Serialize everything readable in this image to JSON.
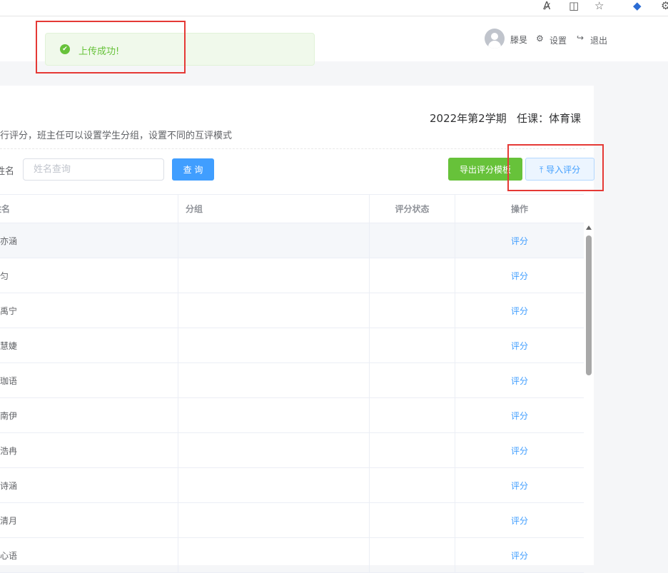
{
  "toast": {
    "message": "上传成功!"
  },
  "header": {
    "username": "滕旻",
    "settings_label": "设置",
    "logout_label": "退出"
  },
  "semester_info": "2022年第2学期   任课：体育课",
  "description": "行评分，班主任可以设置学生分组，设置不同的互评模式",
  "search": {
    "label": "姓名",
    "placeholder": "姓名查询",
    "query_button": "查 询",
    "export_button": "导出评分模板",
    "import_button": "导入评分"
  },
  "table": {
    "headers": {
      "name": "姓名",
      "group": "分组",
      "status": "评分状态",
      "action": "操作"
    },
    "rows": [
      {
        "name": "傅亦涵",
        "group": "",
        "status": "",
        "action": "评分"
      },
      {
        "name": "高匀",
        "group": "",
        "status": "",
        "action": "评分"
      },
      {
        "name": "胡禹宁",
        "group": "",
        "status": "",
        "action": "评分"
      },
      {
        "name": "蒋慧婕",
        "group": "",
        "status": "",
        "action": "评分"
      },
      {
        "name": "林珈语",
        "group": "",
        "status": "",
        "action": "评分"
      },
      {
        "name": "柳南伊",
        "group": "",
        "status": "",
        "action": "评分"
      },
      {
        "name": "沈浩冉",
        "group": "",
        "status": "",
        "action": "评分"
      },
      {
        "name": "苏诗涵",
        "group": "",
        "status": "",
        "action": "评分"
      },
      {
        "name": "陈清月",
        "group": "",
        "status": "",
        "action": "评分"
      },
      {
        "name": "阮心语",
        "group": "",
        "status": "",
        "action": "评分"
      }
    ]
  },
  "colors": {
    "primary": "#409eff",
    "success": "#67c23a",
    "annotation": "#e53935"
  },
  "icons": [
    "read-aloud-icon",
    "split-view-icon",
    "favorites-icon",
    "extension-icon",
    "settings-gear-icon",
    "logout-icon",
    "check-circle-icon",
    "upload-icon"
  ]
}
